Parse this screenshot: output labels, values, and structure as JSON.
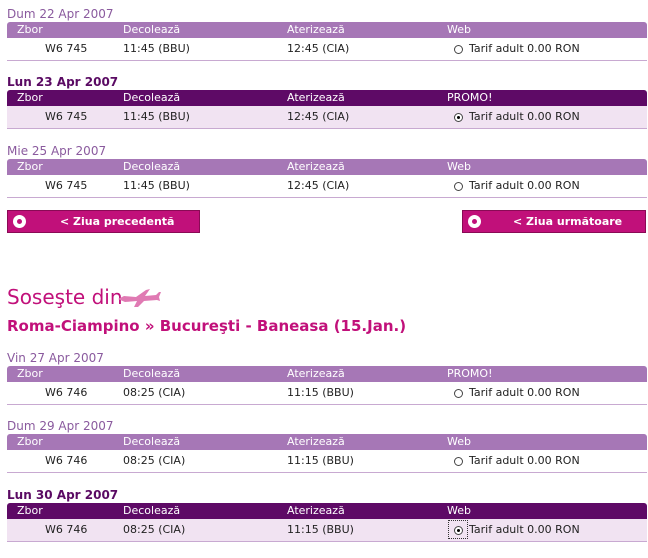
{
  "columns_default": {
    "zbor": "Zbor",
    "decoleaza": "Decolează",
    "aterizeaza": "Aterizează",
    "web": "Web"
  },
  "outbound": [
    {
      "date": "Dum 22 Apr 2007",
      "fourth_header": "Web",
      "flight": "W6 745",
      "departs": "11:45 (BBU)",
      "arrives": "12:45 (CIA)",
      "fare": "Tarif adult 0.00 RON"
    },
    {
      "date": "Lun 23 Apr 2007",
      "fourth_header": "PROMO!",
      "flight": "W6 745",
      "departs": "11:45 (BBU)",
      "arrives": "12:45 (CIA)",
      "fare": "Tarif adult 0.00 RON"
    },
    {
      "date": "Mie 25 Apr 2007",
      "fourth_header": "Web",
      "flight": "W6 745",
      "departs": "11:45 (BBU)",
      "arrives": "12:45 (CIA)",
      "fare": "Tarif adult 0.00 RON"
    }
  ],
  "nav": {
    "prev": "< Ziua precedentă",
    "next": "< Ziua următoare"
  },
  "return_section": {
    "title": "Soseşte din",
    "route": "Roma-Ciampino » Bucureşti - Baneasa (15.Jan.)"
  },
  "inbound": [
    {
      "date": "Vin 27 Apr 2007",
      "fourth_header": "PROMO!",
      "flight": "W6 746",
      "departs": "08:25 (CIA)",
      "arrives": "11:15 (BBU)",
      "fare": "Tarif adult 0.00 RON"
    },
    {
      "date": "Dum 29 Apr 2007",
      "fourth_header": "Web",
      "flight": "W6 746",
      "departs": "08:25 (CIA)",
      "arrives": "11:15 (BBU)",
      "fare": "Tarif adult 0.00 RON"
    },
    {
      "date": "Lun 30 Apr 2007",
      "fourth_header": "Web",
      "flight": "W6 746",
      "departs": "08:25 (CIA)",
      "arrives": "11:15 (BBU)",
      "fare": "Tarif adult 0.00 RON"
    }
  ],
  "colors": {
    "header_light": "#a677b6",
    "header_dark": "#5e0a66",
    "accent": "#c1107a",
    "selected_row": "#f1e3f2"
  },
  "icons": {
    "plane": "airplane-icon",
    "nav_button": "radio-circle-icon"
  }
}
